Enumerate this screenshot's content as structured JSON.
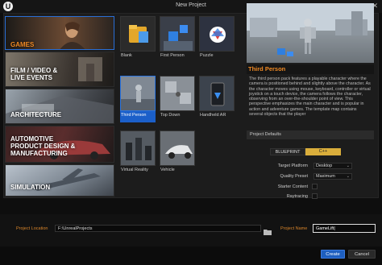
{
  "window": {
    "title": "New Project",
    "logo": "U"
  },
  "categories": [
    {
      "label": "GAMES"
    },
    {
      "label": "FILM / VIDEO &\nLIVE EVENTS"
    },
    {
      "label": "ARCHITECTURE"
    },
    {
      "label": "AUTOMOTIVE\nPRODUCT DESIGN &\nMANUFACTURING"
    },
    {
      "label": "SIMULATION"
    }
  ],
  "templates": [
    {
      "name": "Blank"
    },
    {
      "name": "First Person"
    },
    {
      "name": "Puzzle"
    },
    {
      "name": "Third Person"
    },
    {
      "name": "Top Down"
    },
    {
      "name": "Handheld AR"
    },
    {
      "name": "Virtual Reality"
    },
    {
      "name": "Vehicle"
    }
  ],
  "selected_template": {
    "title": "Third Person",
    "description": "The third person pack features a playable character where the camera is positioned behind and slightly above the character. As the character moves using mouse, keyboard, controller or virtual joystick on a touch device, the camera follows the character, observing from an over-the-shoulder point of view. This perspective emphasizes the main character and is popular in action and adventure games. The template map contains several objects that the player"
  },
  "project_defaults": {
    "header": "Project Defaults",
    "blueprint_label": "BLUEPRINT",
    "cpp_label": "C++",
    "target_platform_label": "Target Platform",
    "target_platform_value": "Desktop",
    "quality_preset_label": "Quality Preset",
    "quality_preset_value": "Maximum",
    "starter_content_label": "Starter Content",
    "raytracing_label": "Raytracing"
  },
  "project_location": {
    "label": "Project Location",
    "value": "F:\\UnrealProjects"
  },
  "project_name": {
    "label": "Project Name",
    "value": "GameLift|"
  },
  "buttons": {
    "create": "Create",
    "cancel": "Cancel"
  },
  "colors": {
    "accent_orange": "#f08a24",
    "selection_blue": "#1b5fc9",
    "cpp_gold": "#d9ad3b"
  }
}
